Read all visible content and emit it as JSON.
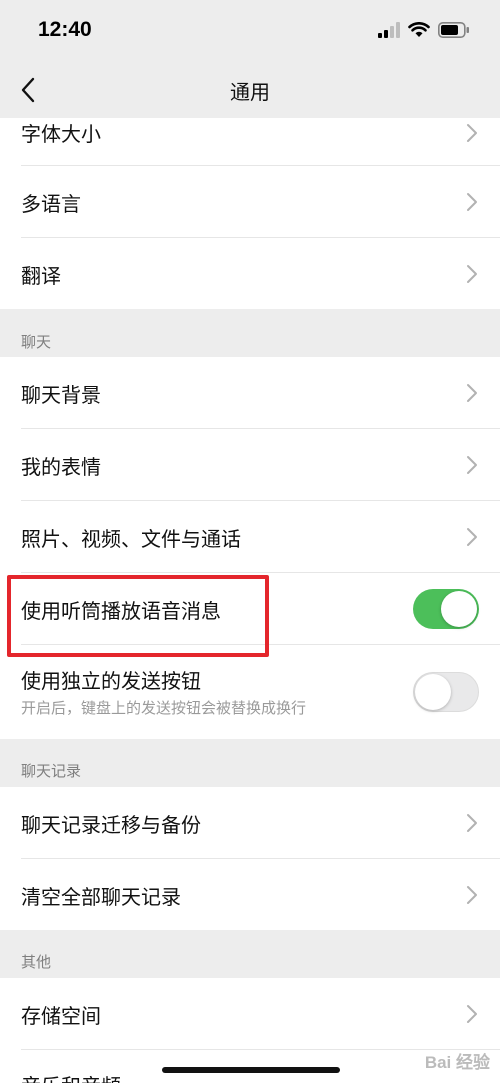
{
  "status_bar": {
    "time": "12:40"
  },
  "nav": {
    "title": "通用"
  },
  "rows_top": [
    {
      "label": "字体大小"
    },
    {
      "label": "多语言"
    },
    {
      "label": "翻译"
    }
  ],
  "sections": {
    "chat": "聊天",
    "chat_history": "聊天记录",
    "other": "其他"
  },
  "chat_rows": {
    "background": "聊天背景",
    "stickers": "我的表情",
    "media": "照片、视频、文件与通话",
    "earpiece": {
      "label": "使用听筒播放语音消息",
      "enabled": true
    },
    "send_button": {
      "label": "使用独立的发送按钮",
      "description": "开启后，键盘上的发送按钮会被替换成换行",
      "enabled": false
    }
  },
  "history_rows": {
    "migrate": "聊天记录迁移与备份",
    "clear": "清空全部聊天记录"
  },
  "other_rows": {
    "storage": "存储空间",
    "music": "音乐和音频"
  },
  "colors": {
    "toggle_on": "#4cbf5a",
    "highlight": "#e4262c"
  },
  "watermark": "Bai 经验"
}
